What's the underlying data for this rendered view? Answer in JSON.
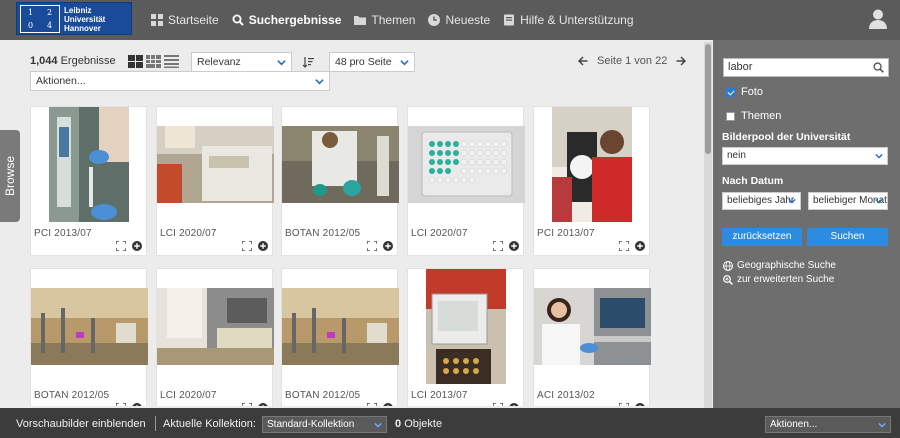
{
  "header": {
    "logo_lines": [
      "Leibniz",
      "Universität",
      "Hannover"
    ],
    "logo_mark": [
      "1",
      "2",
      "0",
      "4"
    ],
    "nav": [
      {
        "label": "Startseite",
        "icon": "grid-icon",
        "active": false
      },
      {
        "label": "Suchergebnisse",
        "icon": "search-icon",
        "active": true
      },
      {
        "label": "Themen",
        "icon": "folder-icon",
        "active": false
      },
      {
        "label": "Neueste",
        "icon": "clock-icon",
        "active": false
      },
      {
        "label": "Hilfe & Unterstützung",
        "icon": "book-icon",
        "active": false
      }
    ],
    "user_icon": "user-icon"
  },
  "browse_tab": "Browse",
  "toolbar": {
    "results_count": "1,044",
    "results_label": "Ergebnisse",
    "sort_select": "Relevanz",
    "per_page_select": "48 pro Seite",
    "actions_select": "Aktionen...",
    "pager_text": "Seite 1 von 22"
  },
  "results": [
    {
      "caption": "PCI 2013/07"
    },
    {
      "caption": "LCI 2020/07"
    },
    {
      "caption": "BOTAN 2012/05"
    },
    {
      "caption": "LCI 2020/07"
    },
    {
      "caption": "PCI 2013/07"
    },
    {
      "caption": "BOTAN 2012/05"
    },
    {
      "caption": "LCI 2020/07"
    },
    {
      "caption": "BOTAN 2012/05"
    },
    {
      "caption": "LCI 2013/07"
    },
    {
      "caption": "ACI 2013/02"
    }
  ],
  "sidebar": {
    "search_value": "labor",
    "filter_foto": "Foto",
    "filter_themen": "Themen",
    "bilderpool_label": "Bilderpool der Universität",
    "bilderpool_value": "nein",
    "datum_label": "Nach Datum",
    "datum_from": "beliebiges Jahr",
    "datum_to": "beliebiger Monat",
    "reset_button": "zurücksetzen",
    "search_button": "Suchen",
    "geo_link": "Geographische Suche",
    "advanced_link": "zur erweiterten Suche"
  },
  "footer": {
    "preview_toggle": "Vorschaubilder einblenden",
    "collection_label": "Aktuelle Kollektion:",
    "collection_select": "Standard-Kollektion",
    "objects_count": "0",
    "objects_label": "Objekte",
    "actions_select": "Aktionen..."
  },
  "colors": {
    "header_bg": "#5b5b5b",
    "sidebar_bg": "#6e6e6e",
    "footer_bg": "#3c3c3c",
    "accent": "#2d8ce0",
    "logo_bg": "#1a4a9a"
  }
}
